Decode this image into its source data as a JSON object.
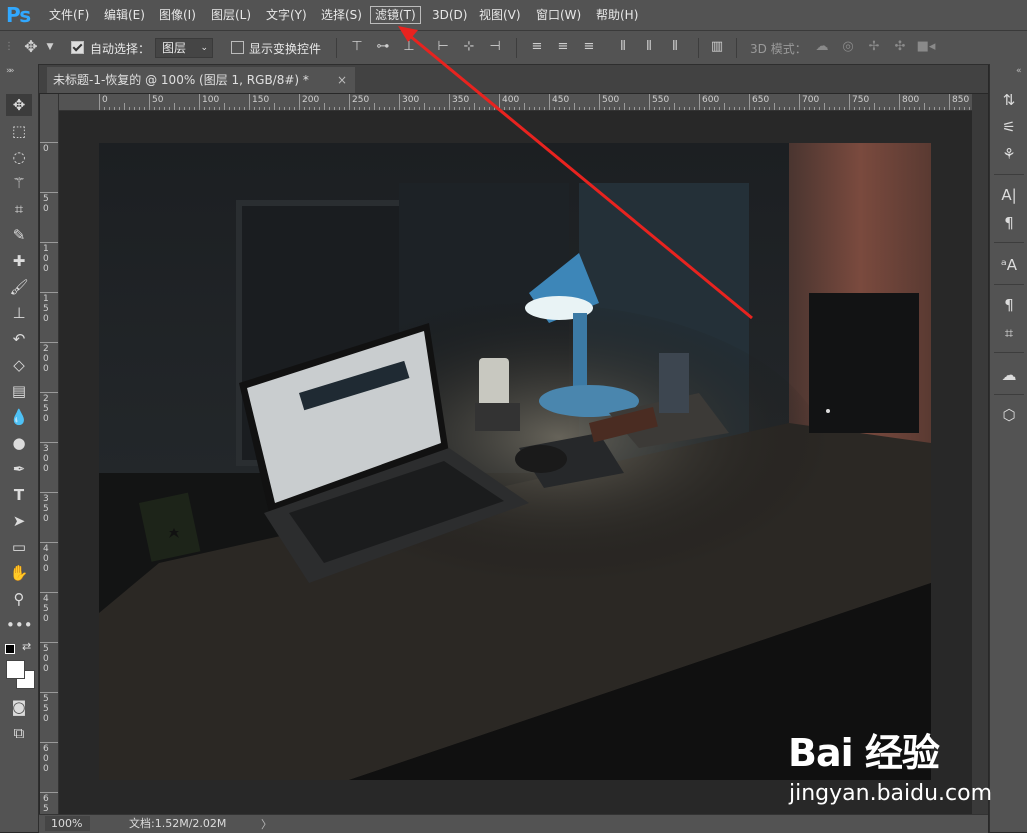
{
  "app": {
    "logo": "Ps"
  },
  "menu": {
    "items": [
      {
        "label": "文件(F)"
      },
      {
        "label": "编辑(E)"
      },
      {
        "label": "图像(I)"
      },
      {
        "label": "图层(L)"
      },
      {
        "label": "文字(Y)"
      },
      {
        "label": "选择(S)"
      },
      {
        "label": "滤镜(T)"
      },
      {
        "label": "3D(D)"
      },
      {
        "label": "视图(V)"
      },
      {
        "label": "窗口(W)"
      },
      {
        "label": "帮助(H)"
      }
    ],
    "highlighted": "滤镜(T)"
  },
  "options": {
    "auto_select_label": "自动选择：",
    "auto_select_checked": true,
    "auto_select_value": "图层",
    "show_transform_label": "显示变换控件",
    "show_transform_checked": false,
    "mode_3d_label": "3D 模式："
  },
  "document": {
    "tab_title": "未标题-1-恢复的 @ 100% (图层 1, RGB/8#) *",
    "tab_close": "×"
  },
  "ruler": {
    "top_labels": [
      "0",
      "50",
      "100",
      "150",
      "200",
      "250",
      "300",
      "350",
      "400",
      "450",
      "500",
      "550",
      "600",
      "650",
      "700",
      "750",
      "800",
      "850"
    ],
    "left_labels": [
      "0",
      "5\n0",
      "1\n0\n0",
      "1\n5\n0",
      "2\n0\n0",
      "2\n5\n0",
      "3\n0\n0",
      "3\n5\n0",
      "4\n0\n0",
      "4\n5\n0",
      "5\n0\n0",
      "5\n5\n0",
      "6\n0\n0",
      "6\n5\n0"
    ]
  },
  "status": {
    "zoom": "100%",
    "doc_info": "文档:1.52M/2.02M",
    "arrow": "〉"
  },
  "watermark": {
    "logo_text": "Bai  经验",
    "url": "jingyan.baidu.com"
  },
  "colors": {
    "accent_ps": "#31a8ff",
    "annotation_arrow": "#e8231f",
    "panel_bg": "#535353"
  },
  "tools_left": [
    "move-icon",
    "marquee-icon",
    "lasso-icon",
    "magic-wand-icon",
    "crop-icon",
    "eyedropper-icon",
    "healing-brush-icon",
    "brush-icon",
    "clone-stamp-icon",
    "history-brush-icon",
    "eraser-icon",
    "gradient-icon",
    "blur-icon",
    "dodge-icon",
    "pen-icon",
    "type-icon",
    "path-selection-icon",
    "rectangle-icon",
    "hand-icon",
    "zoom-icon",
    "more-tools-icon"
  ],
  "tools_right": [
    "history-panel-icon",
    "adjustments-icon",
    "brush-settings-icon",
    "character-icon",
    "paragraph-icon",
    "character-styles-icon",
    "paragraph-styles-icon",
    "properties-icon",
    "creative-cloud-icon",
    "3d-panel-icon"
  ]
}
